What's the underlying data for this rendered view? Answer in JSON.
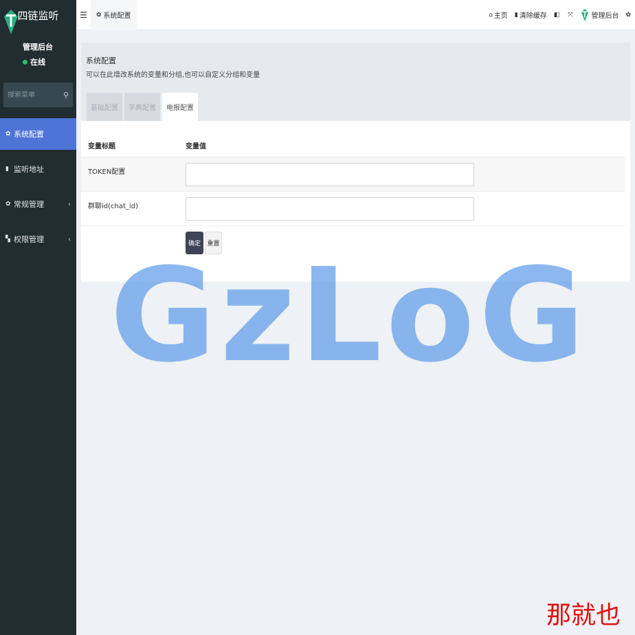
{
  "sidebar": {
    "brand": "四链监听",
    "user": {
      "name": "管理后台",
      "status": "在线"
    },
    "search": {
      "placeholder": "搜索菜单"
    },
    "items": [
      {
        "label": "系统配置",
        "icon": "gear-icon",
        "active": true
      },
      {
        "label": "监听地址",
        "icon": "lock-icon"
      },
      {
        "label": "常规管理",
        "icon": "cogs-icon",
        "has_arrow": true
      },
      {
        "label": "权限管理",
        "icon": "group-icon",
        "has_arrow": true
      }
    ],
    "arrow": "‹"
  },
  "topbar": {
    "menu_toggle": "☰",
    "tab_label": "系统配置",
    "home_label": "主页",
    "clear_cache_label": "清除缓存",
    "user_label": "管理后台"
  },
  "page": {
    "title": "系统配置",
    "description": "可以在此增改系统的变量和分组,也可以自定义分组和变量",
    "tabs": [
      {
        "label": "基础配置",
        "active": false
      },
      {
        "label": "字典配置",
        "active": false
      },
      {
        "label": "电报配置",
        "active": true
      }
    ]
  },
  "form": {
    "col_title": "变量标题",
    "col_value": "变量值",
    "fields": [
      {
        "label": "TOKEN配置",
        "value": ""
      },
      {
        "label": "群聊id(chat_id)",
        "value": ""
      }
    ],
    "submit_label": "确定",
    "reset_label": "重置"
  },
  "watermark": {
    "logo": "GzLoG",
    "text": "那就也"
  },
  "colors": {
    "sidebar_bg": "#222d32",
    "active_menu": "#4e74d8",
    "primary_button": "#3e4356",
    "status_online": "#2bbf6a",
    "watermark_red": "#e01010"
  }
}
